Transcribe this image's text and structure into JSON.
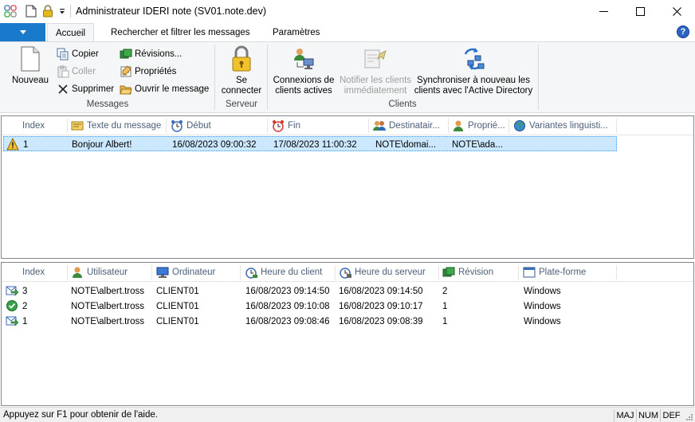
{
  "window": {
    "title": "Administrateur IDERI note (SV01.note.dev)"
  },
  "ribbon": {
    "tabs": [
      "Accueil",
      "Rechercher et filtrer les messages",
      "Paramètres"
    ],
    "groups": {
      "messages": {
        "label": "Messages",
        "new": "Nouveau",
        "copy": "Copier",
        "paste": "Coller",
        "delete": "Supprimer",
        "revisions": "Révisions...",
        "properties": "Propriétés",
        "open": "Ouvrir le message"
      },
      "server": {
        "label": "Serveur",
        "connect": "Se\nconnecter"
      },
      "clients": {
        "label": "Clients",
        "connections": "Connexions de\nclients actives",
        "notify": "Notifier les clients\nimmédiatement",
        "sync": "Synchroniser à nouveau les\nclients avec l'Active Directory"
      }
    }
  },
  "messages_table": {
    "columns": [
      "Index",
      "Texte du message",
      "Début",
      "Fin",
      "Destinatair...",
      "Proprié...",
      "Variantes linguisti..."
    ],
    "rows": [
      {
        "index": "1",
        "text": "Bonjour Albert!",
        "start": "16/08/2023 09:00:32",
        "end": "17/08/2023 11:00:32",
        "recipients": "NOTE\\domai...",
        "owner": "NOTE\\ada...",
        "languages": ""
      }
    ]
  },
  "receipts_table": {
    "columns": [
      "Index",
      "Utilisateur",
      "Ordinateur",
      "Heure du client",
      "Heure du serveur",
      "Révision",
      "Plate-forme"
    ],
    "rows": [
      {
        "status_icon": "arrow-in-icon",
        "index": "3",
        "user": "NOTE\\albert.tross",
        "computer": "CLIENT01",
        "client_time": "16/08/2023 09:14:50",
        "server_time": "16/08/2023 09:14:50",
        "revision": "2",
        "platform": "Windows"
      },
      {
        "status_icon": "check-circle-icon",
        "index": "2",
        "user": "NOTE\\albert.tross",
        "computer": "CLIENT01",
        "client_time": "16/08/2023 09:10:08",
        "server_time": "16/08/2023 09:10:17",
        "revision": "1",
        "platform": "Windows"
      },
      {
        "status_icon": "arrow-in-icon",
        "index": "1",
        "user": "NOTE\\albert.tross",
        "computer": "CLIENT01",
        "client_time": "16/08/2023 09:08:46",
        "server_time": "16/08/2023 09:08:39",
        "revision": "1",
        "platform": "Windows"
      }
    ]
  },
  "statusbar": {
    "text": "Appuyez sur F1 pour obtenir de l'aide.",
    "indicators": [
      "MAJ",
      "NUM",
      "DEF"
    ]
  },
  "colors": {
    "accent": "#1979ca",
    "selection": "#cce8ff",
    "header_text": "#4c607a"
  }
}
